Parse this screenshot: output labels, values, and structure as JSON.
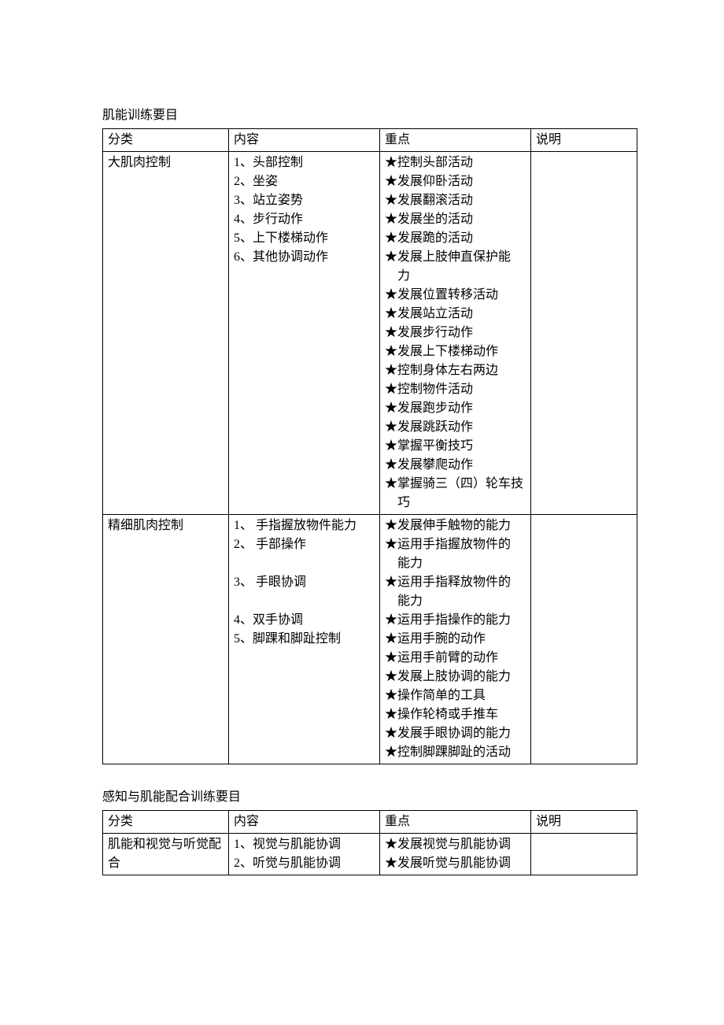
{
  "section1": {
    "title": "肌能训练要目",
    "headers": [
      "分类",
      "内容",
      "重点",
      "说明"
    ],
    "row1": {
      "category": "大肌肉控制",
      "content": [
        "1、头部控制",
        "2、坐姿",
        "3、站立姿势",
        "4、步行动作",
        "5、上下楼梯动作",
        "6、其他协调动作"
      ],
      "focus": [
        "★控制头部活动",
        "★发展仰卧活动",
        "★发展翻滚活动",
        "★发展坐的活动",
        "★发展跪的活动",
        "★发展上肢伸直保护能",
        "　力",
        "★发展位置转移活动",
        "★发展站立活动",
        "★发展步行动作",
        "★发展上下楼梯动作",
        "★控制身体左右两边",
        "★控制物件活动",
        "★发展跑步动作",
        "★发展跳跃动作",
        "★掌握平衡技巧",
        "★发展攀爬动作",
        "★掌握骑三（四）轮车技",
        "　巧"
      ],
      "note": ""
    },
    "row2": {
      "category": "精细肌肉控制",
      "content": [
        "1、 手指握放物件能力",
        "2、 手部操作",
        "",
        "3、 手眼协调",
        "",
        "4、双手协调",
        "5、脚踝和脚趾控制"
      ],
      "focus": [
        "★发展伸手触物的能力",
        "★运用手指握放物件的",
        "　能力",
        "★运用手指释放物件的",
        "　能力",
        "★运用手指操作的能力",
        "★运用手腕的动作",
        "★运用手前臂的动作",
        "★发展上肢协调的能力",
        "★操作简单的工具",
        "★操作轮椅或手推车",
        "★发展手眼协调的能力",
        "★控制脚踝脚趾的活动"
      ],
      "note": ""
    }
  },
  "section2": {
    "title": "感知与肌能配合训练要目",
    "headers": [
      "分类",
      "内容",
      "重点",
      "说明"
    ],
    "row1": {
      "category": "肌能和视觉与听觉配合",
      "content": [
        "1、视觉与肌能协调",
        "2、听觉与肌能协调"
      ],
      "focus": [
        "★发展视觉与肌能协调",
        "★发展听觉与肌能协调"
      ],
      "note": ""
    }
  }
}
